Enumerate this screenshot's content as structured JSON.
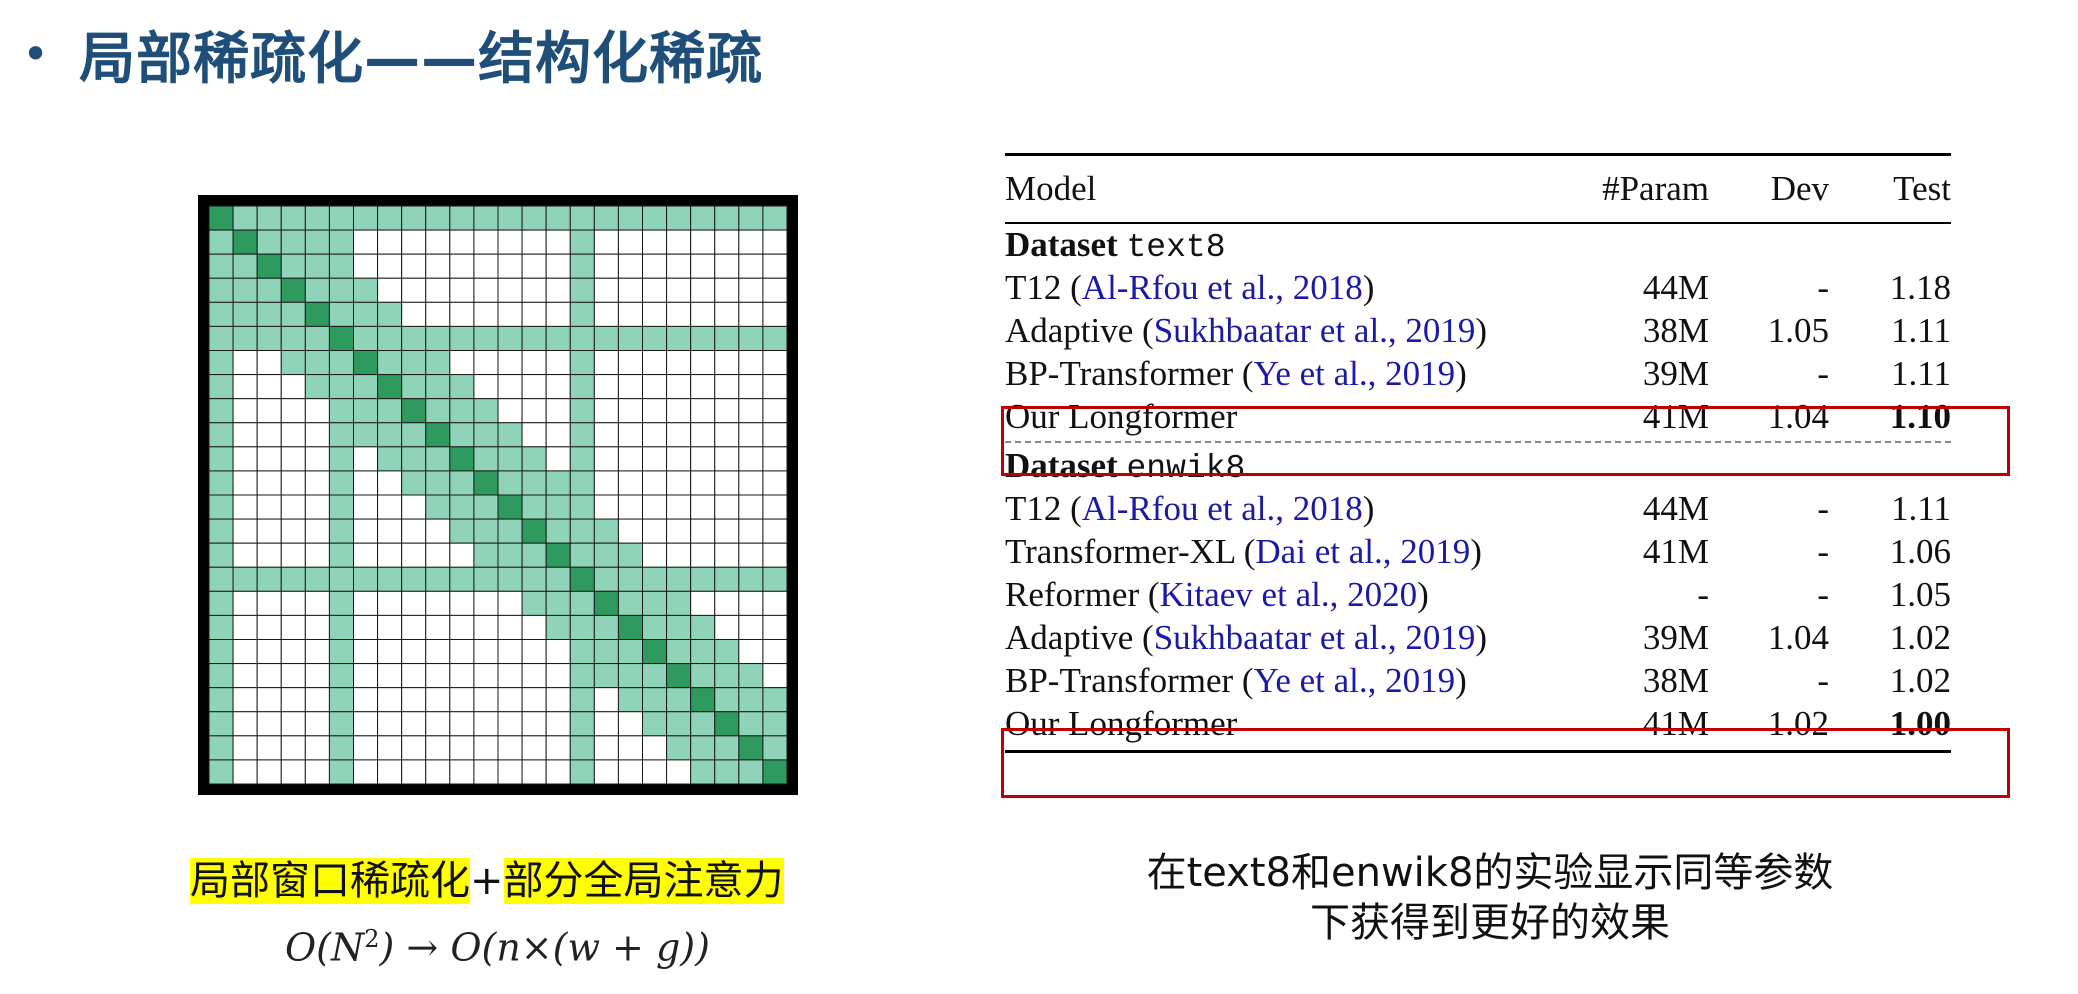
{
  "title": {
    "bullet": "•",
    "text": "局部稀疏化——结构化稀疏"
  },
  "colors": {
    "title": "#1f4e79",
    "cell_light": "#8fd3b8",
    "cell_dark": "#2e9a5e",
    "highlight_box": "#c00000",
    "caption_highlight": "#ffff00"
  },
  "attention_matrix": {
    "size": 24,
    "window_half_width": 3,
    "global_indices": [
      0,
      5,
      15
    ],
    "cell_states": "diagonal = dark green; within local window or global row/column = light green; otherwise white"
  },
  "left_caption": {
    "part1": "局部窗口稀疏化",
    "plus": "+",
    "part2": "部分全局注意力"
  },
  "formula": {
    "lhs": "O(N",
    "exp": "2",
    "rhs": ") → O(n×(w + g))"
  },
  "table": {
    "headers": {
      "model": "Model",
      "param": "#Param",
      "dev": "Dev",
      "test": "Test"
    },
    "sections": [
      {
        "label": "Dataset",
        "dataset": "text8",
        "rows": [
          {
            "name": "T12 (",
            "cite": "Al-Rfou et al., 2018",
            "close": ")",
            "param": "44M",
            "dev": "-",
            "test": "1.18",
            "bold": false
          },
          {
            "name": "Adaptive (",
            "cite": "Sukhbaatar et al., 2019",
            "close": ")",
            "param": "38M",
            "dev": "1.05",
            "test": "1.11",
            "bold": false
          },
          {
            "name": "BP-Transformer (",
            "cite": "Ye et al., 2019",
            "close": ")",
            "param": "39M",
            "dev": "-",
            "test": "1.11",
            "bold": false
          },
          {
            "name": "Our Longformer",
            "cite": "",
            "close": "",
            "param": "41M",
            "dev": "1.04",
            "test": "1.10",
            "bold": true
          }
        ]
      },
      {
        "label": "Dataset",
        "dataset": "enwik8",
        "rows": [
          {
            "name": "T12 (",
            "cite": "Al-Rfou et al., 2018",
            "close": ")",
            "param": "44M",
            "dev": "-",
            "test": "1.11",
            "bold": false
          },
          {
            "name": "Transformer-XL (",
            "cite": "Dai et al., 2019",
            "close": ")",
            "param": "41M",
            "dev": "-",
            "test": "1.06",
            "bold": false
          },
          {
            "name": "Reformer (",
            "cite": "Kitaev et al., 2020",
            "close": ")",
            "param": "-",
            "dev": "-",
            "test": "1.05",
            "bold": false
          },
          {
            "name": "Adaptive (",
            "cite": "Sukhbaatar et al., 2019",
            "close": ")",
            "param": "39M",
            "dev": "1.04",
            "test": "1.02",
            "bold": false
          },
          {
            "name": "BP-Transformer (",
            "cite": "Ye et al., 2019",
            "close": ")",
            "param": "38M",
            "dev": "-",
            "test": "1.02",
            "bold": false
          },
          {
            "name": "Our Longformer",
            "cite": "",
            "close": "",
            "param": "41M",
            "dev": "1.02",
            "test": "1.00",
            "bold": true
          }
        ]
      }
    ]
  },
  "right_caption": {
    "line1": "在text8和enwik8的实验显示同等参数",
    "line2": "下获得到更好的效果"
  }
}
